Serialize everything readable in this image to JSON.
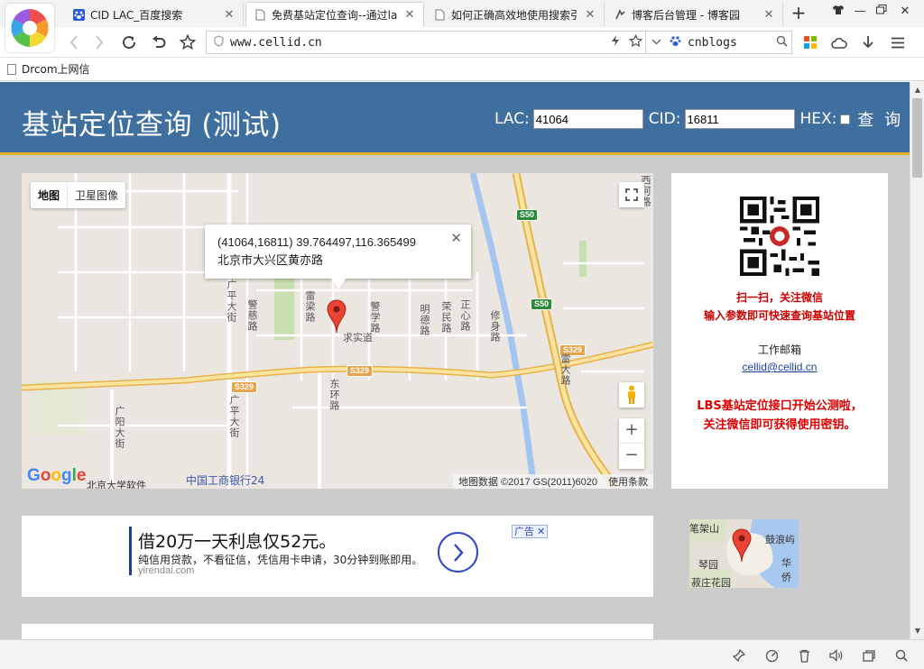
{
  "tabs": [
    {
      "title": "CID LAC_百度搜索",
      "favicon": "paw-icon",
      "active": false
    },
    {
      "title": "免费基站定位查询--通过la",
      "favicon": "document-icon",
      "active": true
    },
    {
      "title": "如何正确高效地使用搜索引",
      "favicon": "document-icon",
      "active": false
    },
    {
      "title": "博客后台管理 - 博客园",
      "favicon": "cnblogs-icon",
      "active": false
    }
  ],
  "address": {
    "url": "www.cellid.cn"
  },
  "search": {
    "engine_text": "cnblogs"
  },
  "bookmarks": [
    {
      "label": "Drcom上网信"
    }
  ],
  "page": {
    "title": "基站定位查询 (测试)",
    "lac_label": "LAC:",
    "lac_value": "41064",
    "cid_label": "CID:",
    "cid_value": "16811",
    "hex_label": "HEX:",
    "hex_checked": false,
    "query_label": "查 询"
  },
  "map": {
    "type_map": "地图",
    "type_satellite": "卫星图像",
    "info_line1": "(41064,16811) 39.764497,116.365499",
    "info_line2": "北京市大兴区黄亦路",
    "attribution": "地图数据 ©2017 GS(2011)6020",
    "terms": "使用条款",
    "brand": "Google",
    "labels": [
      "S50",
      "S50",
      "S329",
      "S329",
      "S329",
      "广平大街",
      "警慈路",
      "雷梁路",
      "警学路",
      "明德路",
      "荣民路",
      "正心路",
      "修身路",
      "求实道",
      "东环路",
      "广平大街",
      "广阳大街",
      "雷大路",
      "西河路",
      "中国工商银行24",
      "北京大学软件"
    ]
  },
  "side": {
    "scan_line1": "扫一扫，关注微信",
    "scan_line2": "输入参数即可快速查询基站位置",
    "email_label": "工作邮箱",
    "email": "cellid@cellid.cn",
    "notice_line1": "LBS基站定位接口开始公测啦，",
    "notice_line2": "关注微信即可获得使用密钥。"
  },
  "ad": {
    "headline": "借20万一天利息仅52元。",
    "subline": "纯信用贷款，不看征信，凭信用卡申请，30分钟到账即用。",
    "domain": "yirendai.com",
    "tag": "广告"
  },
  "minimap": {
    "labels": [
      "笔架山",
      "鼓浪屿",
      "琴园",
      "华侨",
      "菽庄花园"
    ]
  }
}
